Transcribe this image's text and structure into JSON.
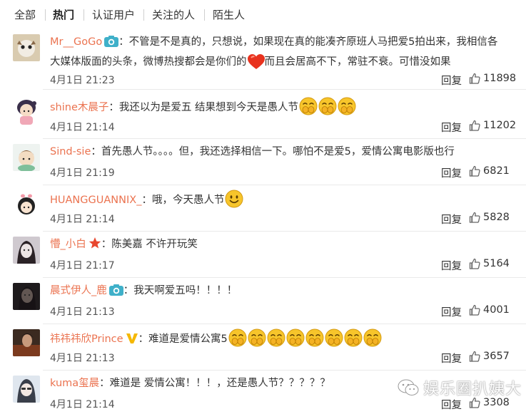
{
  "tabs": [
    "全部",
    "热门",
    "认证用户",
    "关注的人",
    "陌生人"
  ],
  "active_tab": "热门",
  "reply_label": "回复",
  "comments": [
    {
      "user": "Mr__GoGo",
      "badge": "camera",
      "text_a": "：不管是不是真的，只想说，如果现在真的能凑齐原班人马把爱5拍出来，我相信各",
      "text_b": "大媒体版面的头条，微博热搜都会是你们的",
      "text_c": "而且会居高不下，常驻不衰。可惜没如果",
      "time": "4月1日 21:23",
      "likes": "11898"
    },
    {
      "user": "shine木晨子",
      "badge": "",
      "text_a": "：我还以为是爱五 结果想到今天是愚人节",
      "emoji_count": 3,
      "time": "4月1日 21:14",
      "likes": "11202"
    },
    {
      "user": "Sind-sie",
      "badge": "",
      "text_a": "：首先愚人节。。。。但，我还选择相信一下。哪怕不是爱5，爱情公寓电影版也行",
      "time": "4月1日 21:19",
      "likes": "6821"
    },
    {
      "user": "HUANGGUANNIX_",
      "badge": "",
      "text_a": "：哦，今天愚人节",
      "time": "4月1日 21:14",
      "likes": "5828"
    },
    {
      "user": "懵_小白",
      "badge": "star",
      "text_a": "：陈美嘉 不许开玩笑",
      "time": "4月1日 21:17",
      "likes": "5164"
    },
    {
      "user": "晨式伊人_鹿",
      "badge": "camera",
      "text_a": "：我天啊爱五吗！！！！",
      "time": "4月1日 21:13",
      "likes": "4001"
    },
    {
      "user": "祎祎祎欣Prince",
      "badge": "v",
      "text_a": "：难道是爱情公寓5",
      "emoji_count": 8,
      "time": "4月1日 21:13",
      "likes": "3657"
    },
    {
      "user": "kuma玺晨",
      "badge": "",
      "text_a": "：难道是  爱情公寓！！！，还是愚人节？？？？？",
      "time": "4月1日 21:14",
      "likes": "3308"
    }
  ],
  "watermark": "娱乐圈扒姨大",
  "colors": {
    "username": "#eb7350",
    "camera_badge": "#3fb0c9",
    "star_badge": "#e8472f",
    "v_badge": "#f5b800",
    "emoji": "#f7c52b"
  }
}
